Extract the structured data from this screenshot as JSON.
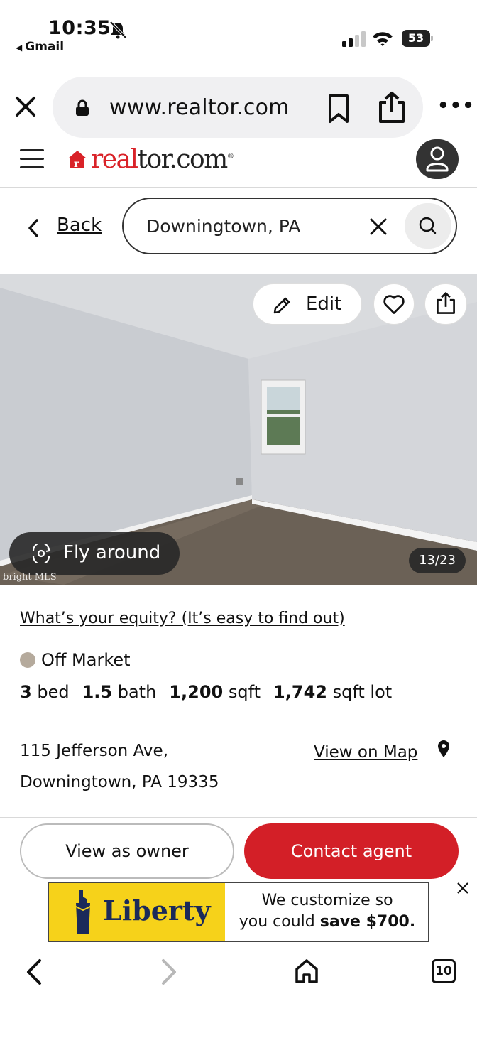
{
  "status_bar": {
    "time": "10:35",
    "back_app": "Gmail",
    "battery": "53",
    "icons": [
      "bell-slash-icon",
      "signal-icon",
      "wifi-icon",
      "battery-icon"
    ]
  },
  "browser": {
    "url": "www.realtor.com",
    "icons": [
      "close-icon",
      "lock-icon",
      "bookmark-icon",
      "share-icon",
      "more-icon"
    ]
  },
  "site": {
    "logo_red": "real",
    "logo_dark": "tor.com",
    "logo_mark": "®"
  },
  "search": {
    "back_label": "Back",
    "query": "Downingtown, PA"
  },
  "photo": {
    "edit_label": "Edit",
    "fly_label": "Fly around",
    "counter": "13/23",
    "watermark": "bright MLS"
  },
  "listing": {
    "equity_link": "What’s your equity? (It’s easy to find out)",
    "status": "Off Market",
    "status_color": "#b5aa9c",
    "beds_value": "3",
    "beds_unit": "bed",
    "baths_value": "1.5",
    "baths_unit": "bath",
    "sqft_value": "1,200",
    "sqft_unit": "sqft",
    "lot_value": "1,742",
    "lot_unit": "sqft lot",
    "address_line1": "115 Jefferson Ave,",
    "address_line2": "Downingtown, PA 19335",
    "map_link": "View on Map"
  },
  "actions": {
    "owner_label": "View as owner",
    "contact_label": "Contact agent",
    "contact_color": "#d31f27"
  },
  "ad": {
    "brand": "Liberty",
    "line1": "We customize so",
    "line2_prefix": "you could ",
    "line2_bold": "save $700."
  },
  "toolbar": {
    "tab_count": "10"
  }
}
